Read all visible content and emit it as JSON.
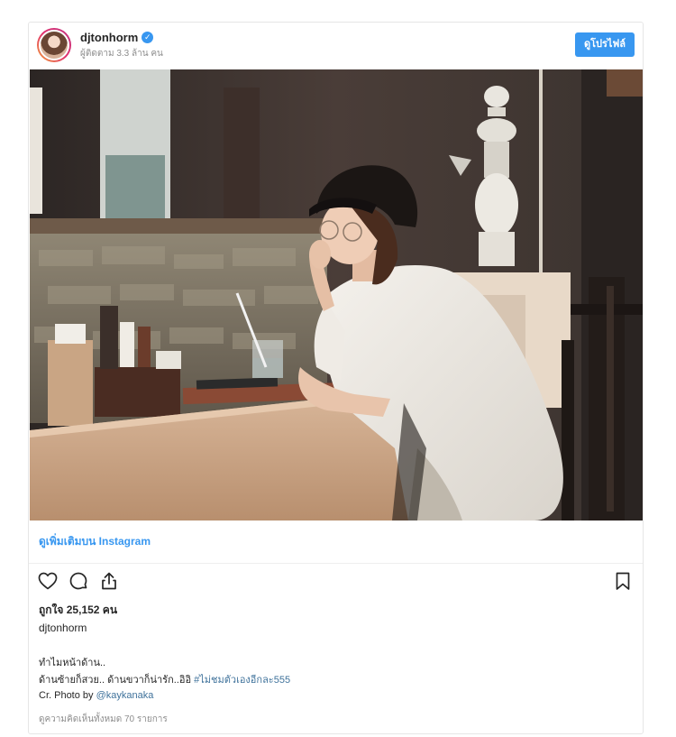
{
  "header": {
    "username": "djtonhorm",
    "verified_icon": "verified-check-icon",
    "followers": "ผู้ติดตาม 3.3 ล้าน คน",
    "profile_button": "ดูโปรไฟล์"
  },
  "post": {
    "more_link": "ดูเพิ่มเติมบน Instagram",
    "likes": "ถูกใจ 25,152 คน",
    "caption_user": "djtonhorm",
    "caption_line1": "ทำไมหน้าด้าน..",
    "caption_line2_text": "ด้านซ้ายก็สวย.. ด้านขวาก็น่ารัก..อิอิ ",
    "caption_line2_hashtag": "#ไม่ชมตัวเองอีกละ555",
    "caption_line3_text": "Cr. Photo by ",
    "caption_line3_mention": "@kaykanaka",
    "comments": "ดูความคิดเห็นทั้งหมด 70 รายการ"
  },
  "icons": {
    "like": "heart-icon",
    "comment": "comment-icon",
    "share": "share-icon",
    "save": "bookmark-icon"
  },
  "colors": {
    "accent": "#3897f0",
    "link": "#3f729b",
    "muted": "#8e8e8e"
  }
}
